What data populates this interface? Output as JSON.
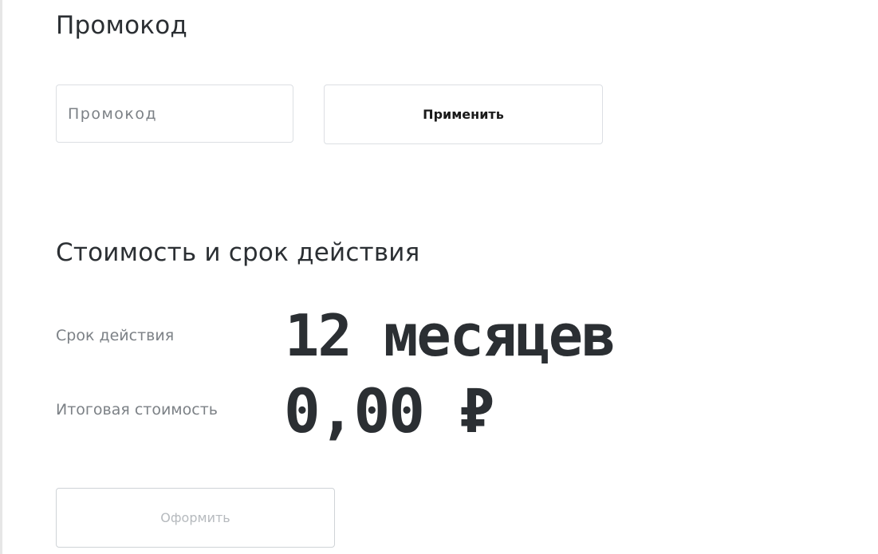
{
  "promo": {
    "heading": "Промокод",
    "input_value": "",
    "input_placeholder": "Промокод",
    "apply_label": "Применить"
  },
  "cost": {
    "heading": "Стоимость и срок действия",
    "term_label": "Срок действия",
    "term_value": "12 месяцев",
    "total_label": "Итоговая стоимость",
    "total_value": "0,00 ₽"
  },
  "actions": {
    "submit_label": "Оформить",
    "submit_disabled": true
  },
  "colors": {
    "text": "#2b2f33",
    "muted_text": "#7c8186",
    "border": "#dcdfe3",
    "disabled_text": "#b6babe"
  }
}
